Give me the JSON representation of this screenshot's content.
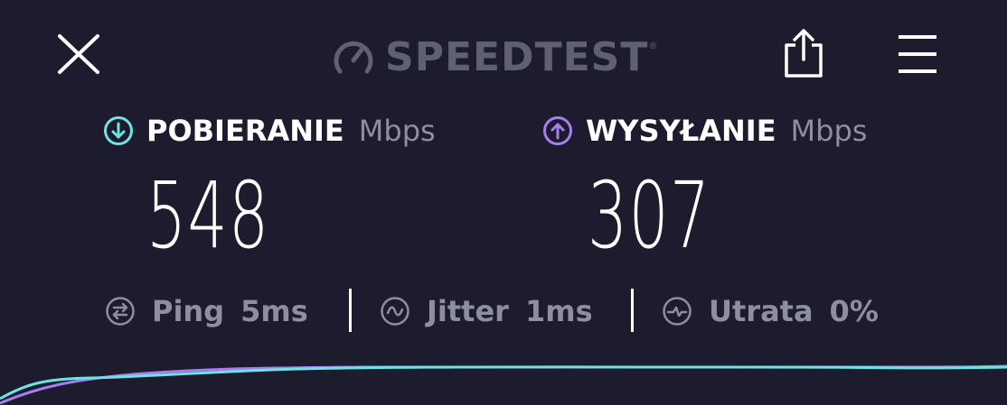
{
  "header": {
    "logo_text": "SPEEDTEST",
    "logo_mark": "®",
    "icons": {
      "close": "close-icon",
      "share": "share-icon",
      "menu": "menu-icon",
      "logo": "gauge-icon"
    }
  },
  "download": {
    "label": "POBIERANIE",
    "unit": "Mbps",
    "value": "548",
    "icon": "arrow-down-circle-icon",
    "color": "#6fe3e3"
  },
  "upload": {
    "label": "WYSYŁANIE",
    "unit": "Mbps",
    "value": "307",
    "icon": "arrow-up-circle-icon",
    "color": "#a77ef0"
  },
  "stats": {
    "ping": {
      "label": "Ping",
      "value": "5ms",
      "icon": "ping-icon"
    },
    "jitter": {
      "label": "Jitter",
      "value": "1ms",
      "icon": "jitter-icon"
    },
    "loss": {
      "label": "Utrata",
      "value": "0%",
      "icon": "packet-loss-icon"
    }
  },
  "colors": {
    "background": "#1c1c2e",
    "muted": "#8d8e9f",
    "logo": "#5f6172",
    "download": "#6fe3e3",
    "upload": "#a77ef0"
  }
}
